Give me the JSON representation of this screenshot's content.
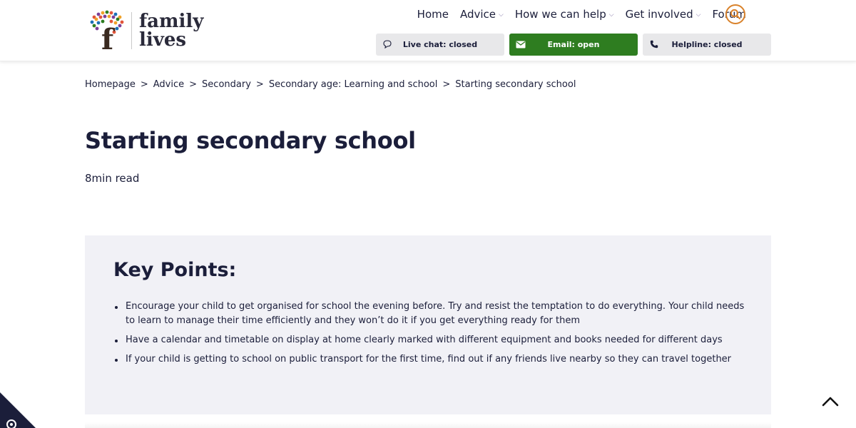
{
  "logo": {
    "line1": "family",
    "line2": "lives"
  },
  "nav": [
    {
      "label": "Home",
      "dropdown": false
    },
    {
      "label": "Advice",
      "dropdown": true
    },
    {
      "label": "How we can help",
      "dropdown": true
    },
    {
      "label": "Get involved",
      "dropdown": true
    },
    {
      "label": "Forum",
      "dropdown": false
    }
  ],
  "search": {
    "icon": "search-icon",
    "color": "#d9822b"
  },
  "contact": {
    "chat": {
      "label": "Live chat: closed",
      "icon": "chat-bubble-icon"
    },
    "email": {
      "label": "Email: open",
      "icon": "envelope-icon",
      "color": "#2e7d20"
    },
    "helpline": {
      "label": "Helpline: closed",
      "icon": "phone-icon"
    }
  },
  "breadcrumb": [
    "Homepage",
    "Advice",
    "Secondary",
    "Secondary age: Learning and school",
    "Starting secondary school"
  ],
  "breadcrumb_separator": ">",
  "page": {
    "title": "Starting secondary school",
    "read_time": "8min read"
  },
  "key_points": {
    "heading": "Key Points:",
    "items": [
      "Encourage your child to get organised for school the evening before. Try and resist the temptation to do everything. Your child needs to learn to manage their time efficiently and they won’t do it if you get everything ready for them",
      "Have a calendar and timetable on display at home clearly marked with different equipment and books needed for different days",
      "If your child is getting to school on public transport for the first time, find out if any friends live nearby so they can travel together"
    ]
  },
  "colors": {
    "text": "#1b1e3a",
    "panel": "#f1f1f6",
    "accent": "#d9822b"
  }
}
